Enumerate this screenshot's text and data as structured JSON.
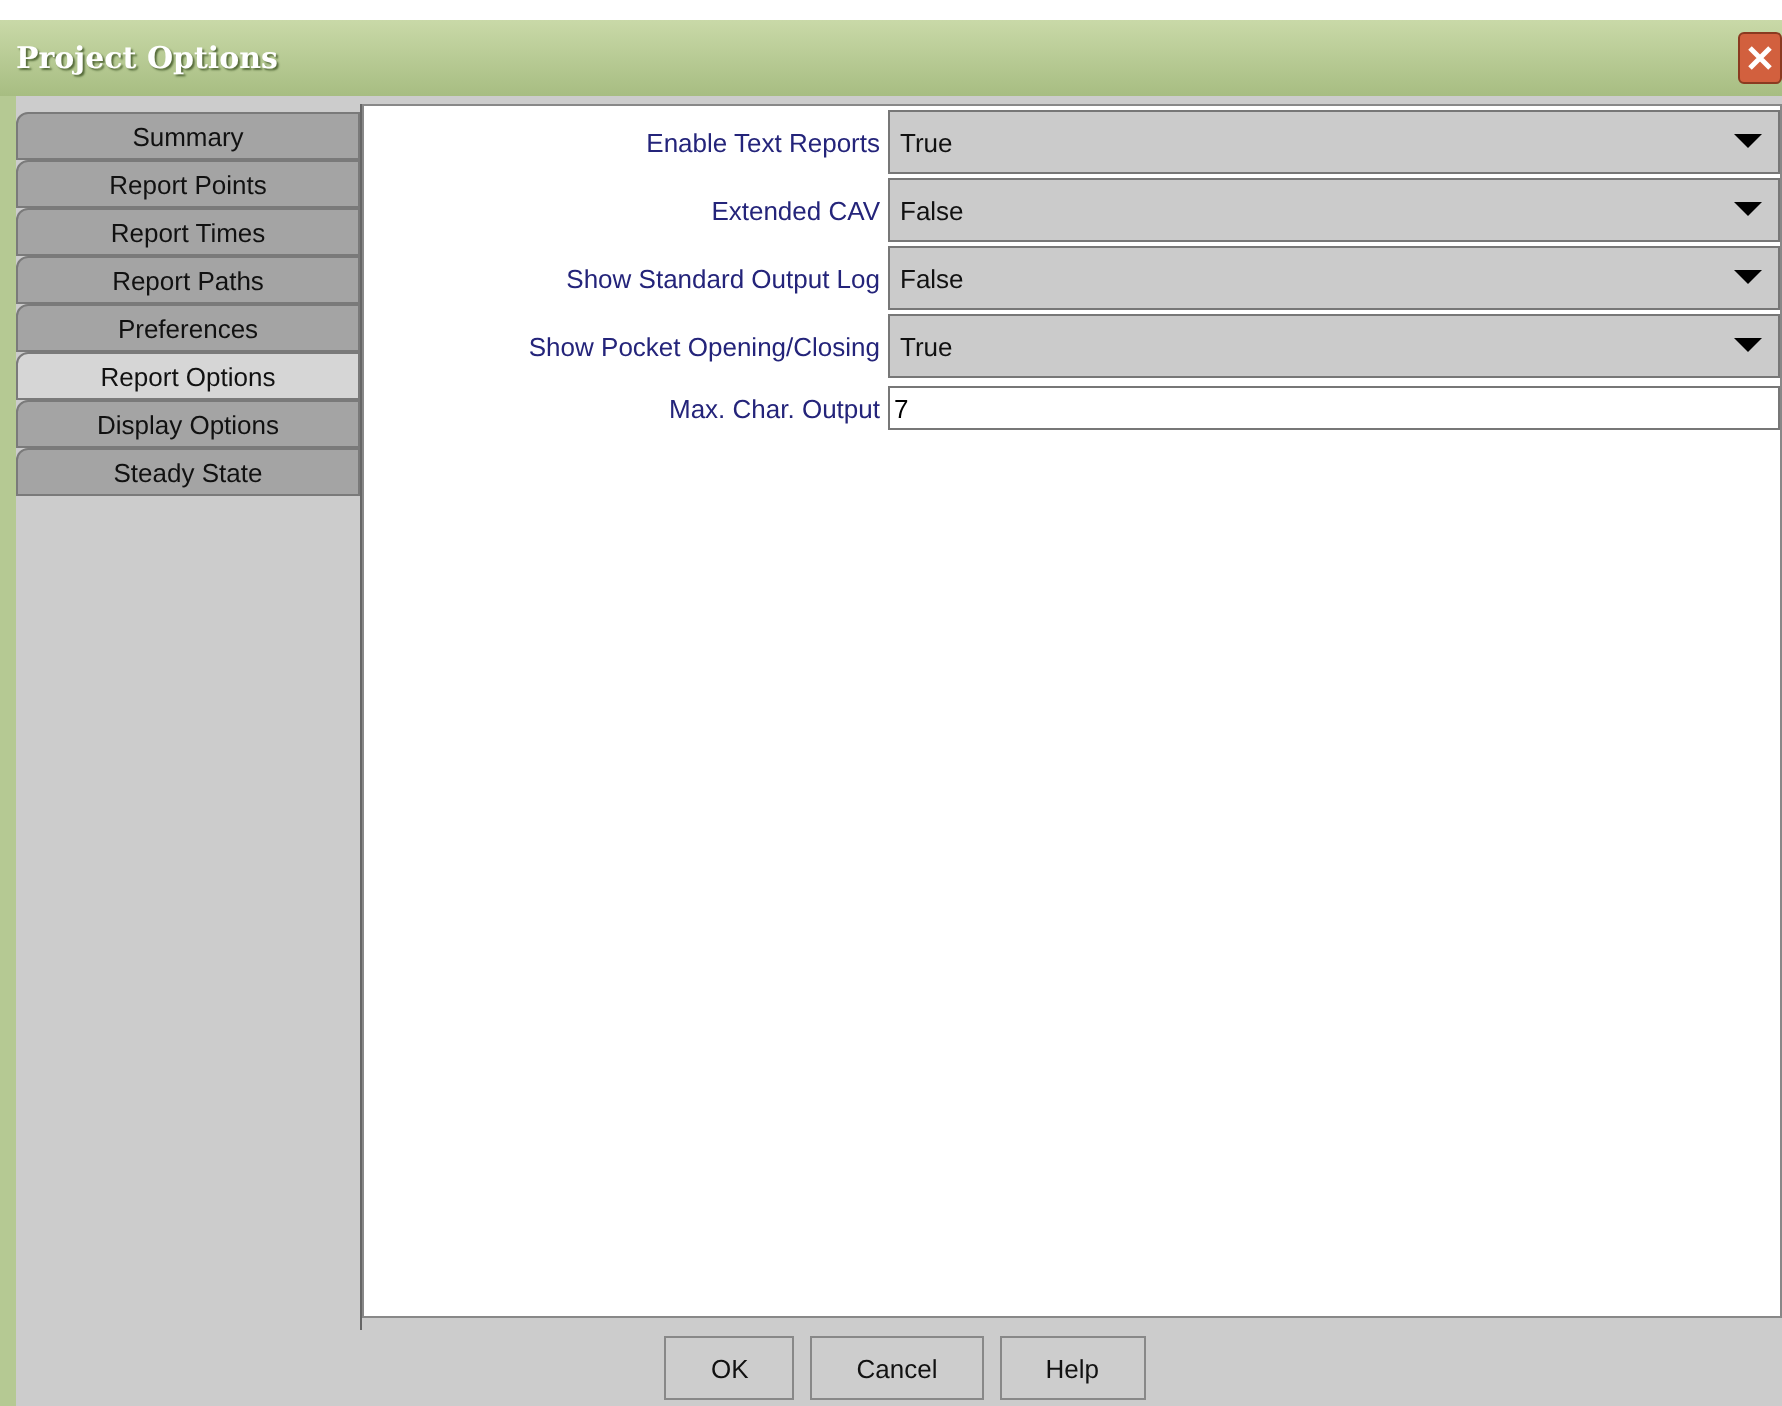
{
  "window": {
    "title": "Project Options"
  },
  "tabs": [
    {
      "label": "Summary",
      "selected": false
    },
    {
      "label": "Report Points",
      "selected": false
    },
    {
      "label": "Report Times",
      "selected": false
    },
    {
      "label": "Report Paths",
      "selected": false
    },
    {
      "label": "Preferences",
      "selected": false
    },
    {
      "label": "Report Options",
      "selected": true
    },
    {
      "label": "Display Options",
      "selected": false
    },
    {
      "label": "Steady State",
      "selected": false
    }
  ],
  "options": [
    {
      "label": "Enable Text Reports",
      "kind": "dropdown",
      "value": "True"
    },
    {
      "label": "Extended CAV",
      "kind": "dropdown",
      "value": "False"
    },
    {
      "label": "Show Standard Output Log",
      "kind": "dropdown",
      "value": "False"
    },
    {
      "label": "Show Pocket Opening/Closing",
      "kind": "dropdown",
      "value": "True"
    },
    {
      "label": "Max. Char. Output",
      "kind": "text",
      "value": "7"
    }
  ],
  "buttons": [
    "OK",
    "Cancel",
    "Help"
  ]
}
